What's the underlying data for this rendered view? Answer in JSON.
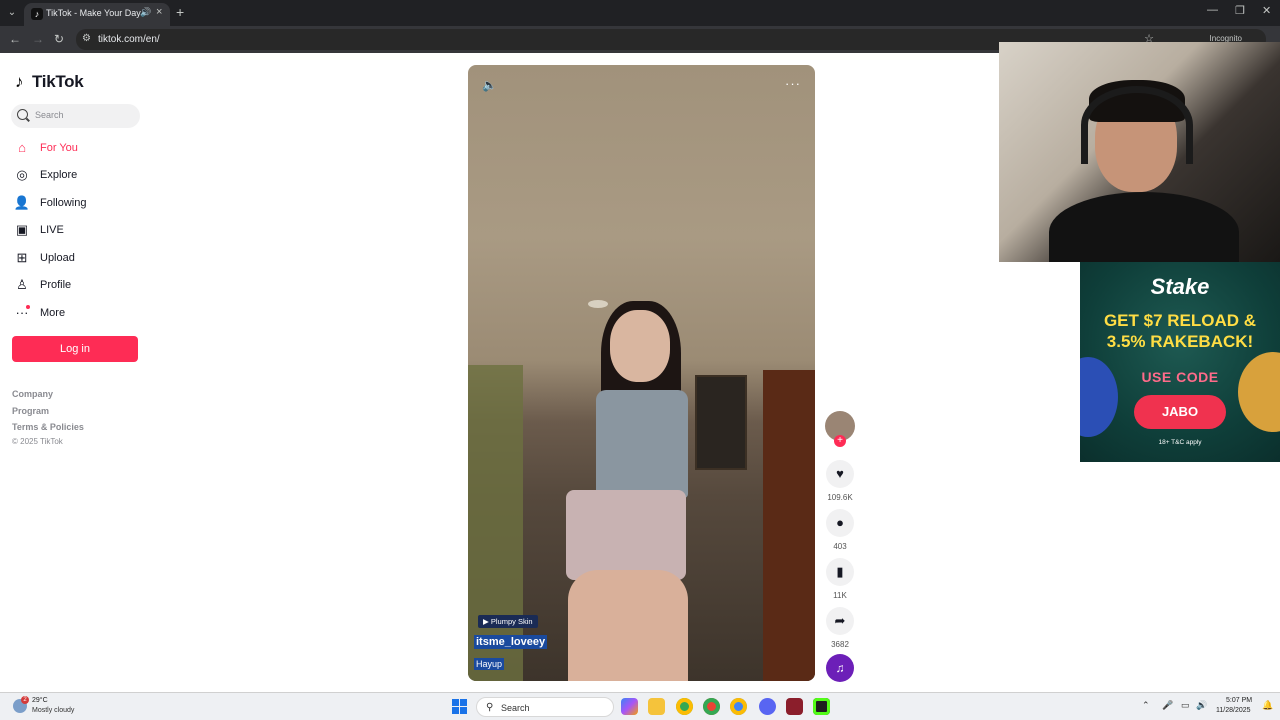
{
  "browser": {
    "tab_title": "TikTok - Make Your Day",
    "url": "tiktok.com/en/",
    "incognito_label": "Incognito"
  },
  "sidebar": {
    "logo_text": "TikTok",
    "search_placeholder": "Search",
    "items": [
      {
        "label": "For You",
        "icon": "home-icon",
        "active": true
      },
      {
        "label": "Explore",
        "icon": "compass-icon"
      },
      {
        "label": "Following",
        "icon": "following-icon"
      },
      {
        "label": "LIVE",
        "icon": "live-icon"
      },
      {
        "label": "Upload",
        "icon": "upload-icon"
      },
      {
        "label": "Profile",
        "icon": "profile-icon"
      },
      {
        "label": "More",
        "icon": "more-icon"
      }
    ],
    "login_label": "Log in",
    "footer": {
      "company": "Company",
      "program": "Program",
      "terms": "Terms & Policies",
      "copyright": "© 2025 TikTok"
    }
  },
  "video": {
    "tag": "Plumpy Skin",
    "author": "itsme_loveey",
    "description": "Hayup"
  },
  "actions": {
    "likes": "109.6K",
    "comments": "403",
    "saves": "11K",
    "shares": "3682"
  },
  "ad": {
    "brand": "Stake",
    "headline_line1": "GET $7 RELOAD &",
    "headline_line2": "3.5% RAKEBACK!",
    "code_label": "USE CODE",
    "code": "JABO",
    "disclaimer": "18+ T&C apply"
  },
  "taskbar": {
    "temperature": "29°C",
    "weather": "Mostly cloudy",
    "weather_badge": "2",
    "search_label": "Search",
    "time": "5:07 PM",
    "date": "11/28/2025"
  },
  "colors": {
    "accent": "#fe2c55",
    "browser_bg": "#202124"
  }
}
